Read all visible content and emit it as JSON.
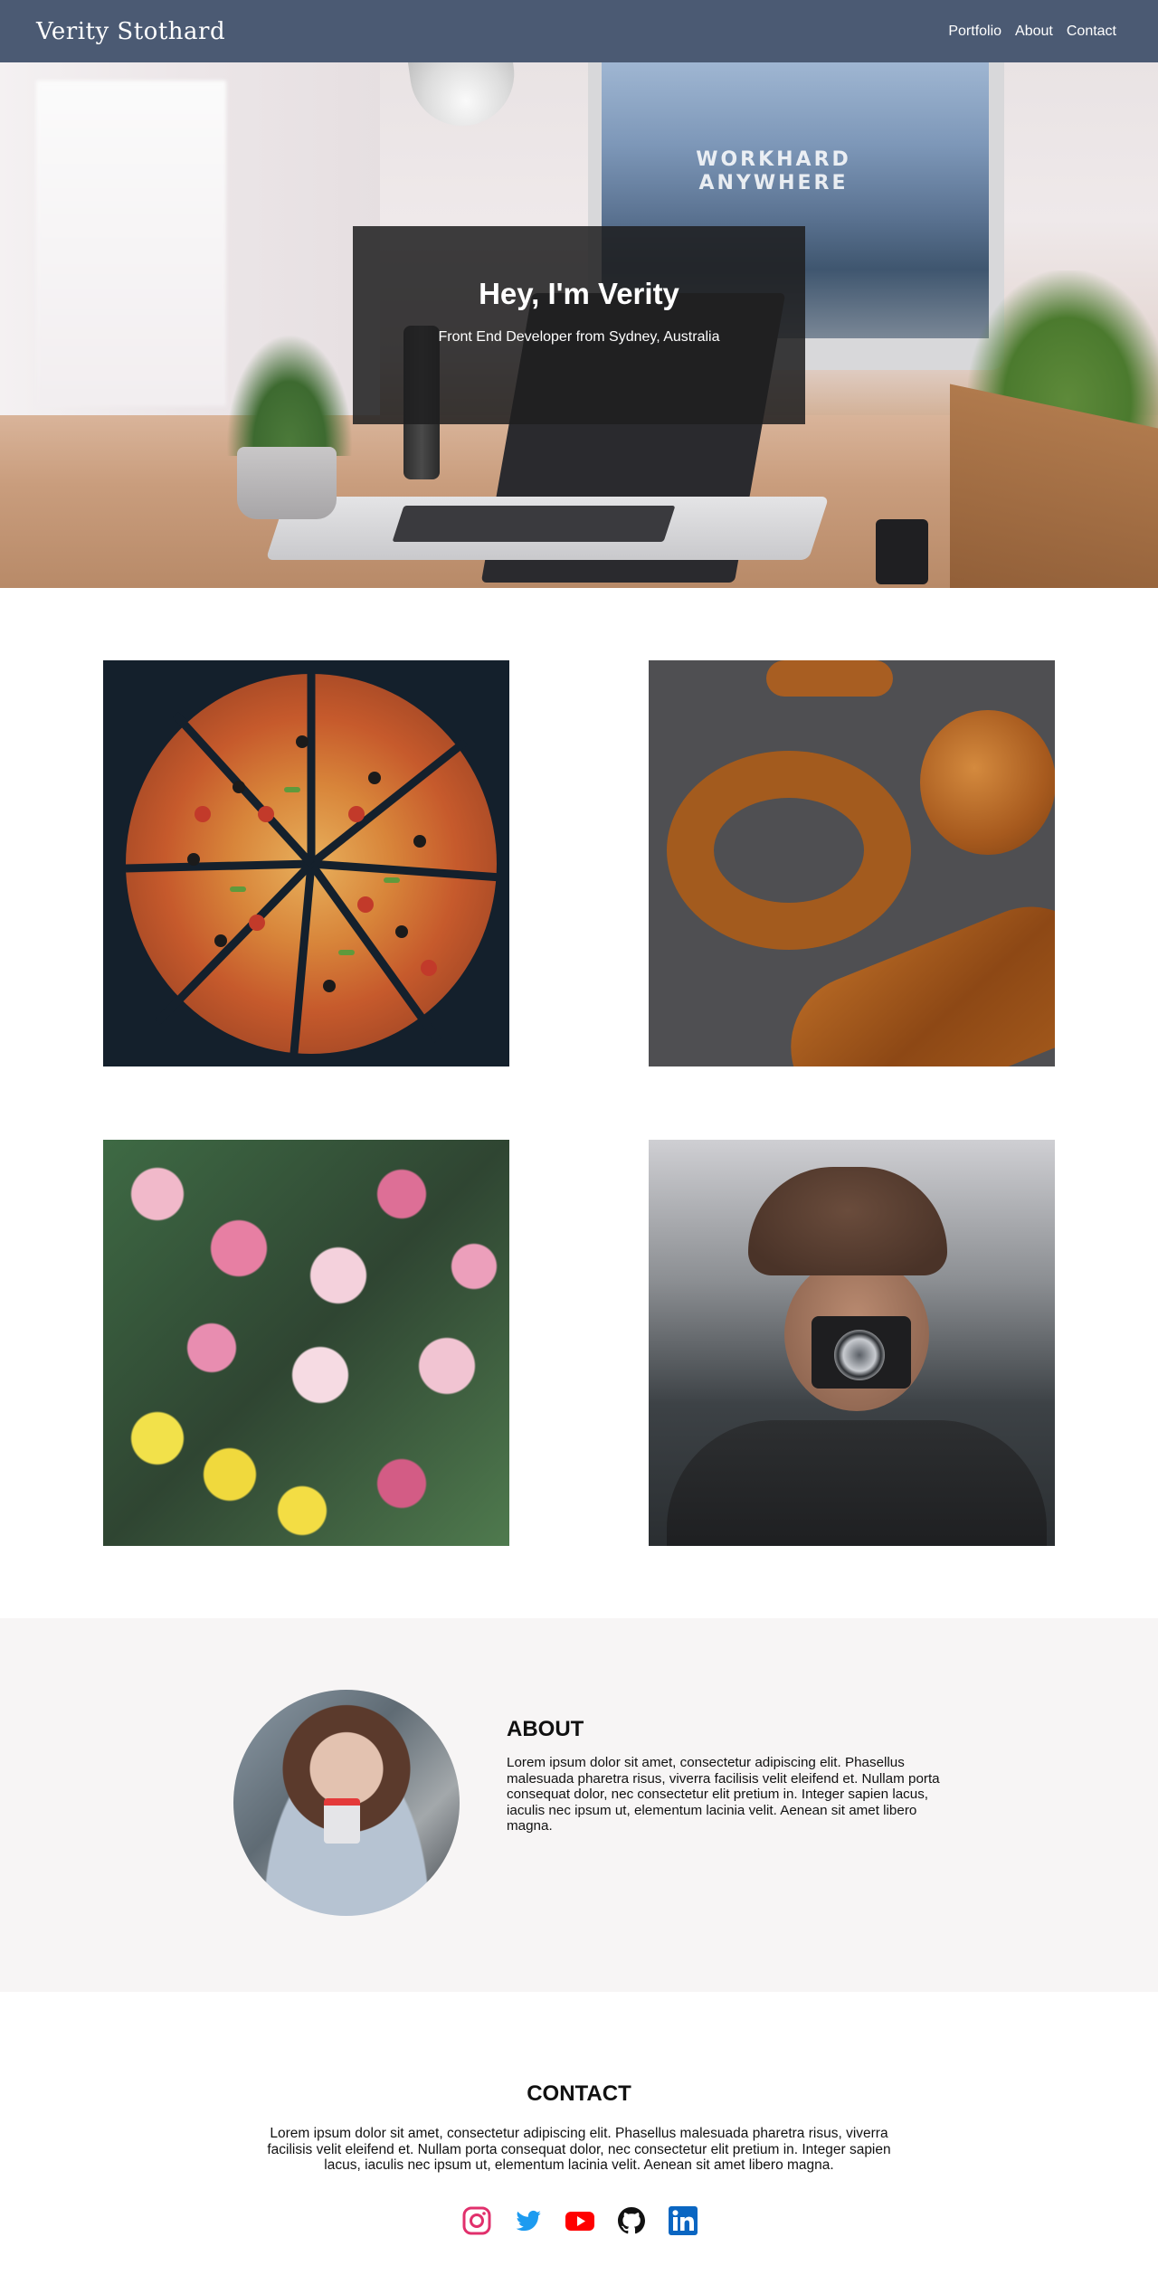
{
  "nav": {
    "brand": "Verity Stothard",
    "links": [
      "Portfolio",
      "About",
      "Contact"
    ]
  },
  "hero": {
    "title": "Hey, I'm Verity",
    "subtitle": "Front End Developer from Sydney, Australia",
    "screen_text": "WORKHARD ANYWHERE"
  },
  "gallery": {
    "images": [
      "pizza-image",
      "pretzel-image",
      "tulips-image",
      "photographer-image"
    ]
  },
  "about": {
    "title": "ABOUT",
    "body": "Lorem ipsum dolor sit amet, consectetur adipiscing elit. Phasellus malesuada pharetra risus, viverra facilisis velit eleifend et. Nullam porta consequat dolor, nec consectetur elit pretium in. Integer sapien lacus, iaculis nec ipsum ut, elementum lacinia velit. Aenean sit amet libero magna."
  },
  "contact": {
    "title": "CONTACT",
    "body": "Lorem ipsum dolor sit amet, consectetur adipiscing elit. Phasellus malesuada pharetra risus, viverra facilisis velit eleifend et. Nullam porta consequat dolor, nec consectetur elit pretium in. Integer sapien lacus, iaculis nec ipsum ut, elementum lacinia velit. Aenean sit amet libero magna.",
    "socials": [
      "instagram-icon",
      "twitter-icon",
      "youtube-icon",
      "github-icon",
      "linkedin-icon"
    ]
  },
  "colors": {
    "nav_bg": "#4b5a73",
    "about_bg": "#f7f5f5",
    "instagram": "#e1306c",
    "twitter": "#1d9bf0",
    "youtube": "#ff0000",
    "github": "#111111",
    "linkedin": "#0a66c2"
  }
}
